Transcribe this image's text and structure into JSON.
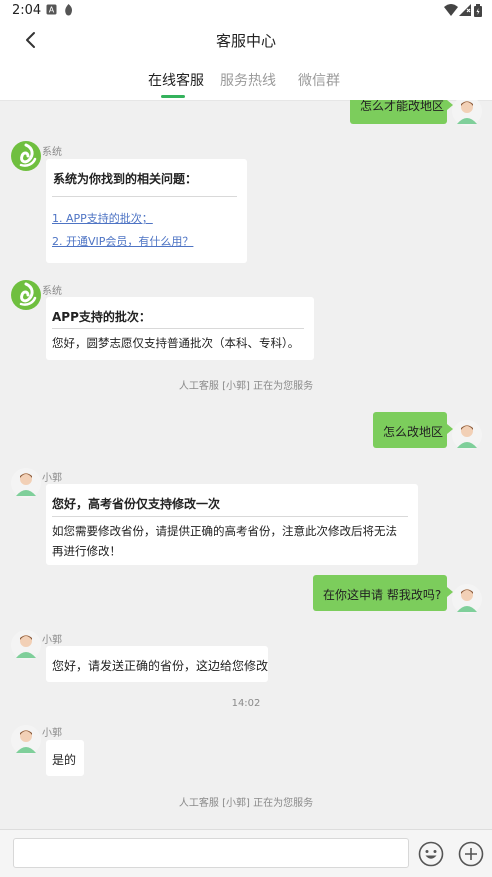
{
  "status_bar": {
    "time": "2:04"
  },
  "header": {
    "title": "客服中心",
    "tabs": [
      {
        "label": "在线客服",
        "active": true
      },
      {
        "label": "服务热线",
        "active": false
      },
      {
        "label": "微信群",
        "active": false
      }
    ]
  },
  "colors": {
    "accent": "#34b25c",
    "my_bubble": "#7ccd5c",
    "link": "#4e74c4",
    "background": "#f0f0f0"
  },
  "messages": {
    "m0": {
      "text": "怎么才能改地区"
    },
    "m1": {
      "sender": "系统",
      "title": "系统为你找到的相关问题：",
      "links": [
        "1. APP支持的批次；",
        "2. 开通VIP会员，有什么用？"
      ]
    },
    "m2": {
      "sender": "系统",
      "title": "APP支持的批次：",
      "body": "您好，圆梦志愿仅支持普通批次（本科、专科）。"
    },
    "notice1": "人工客服 [小郭] 正在为您服务",
    "m3": {
      "text": "怎么改地区"
    },
    "m4": {
      "sender": "小郭",
      "title": "您好，高考省份仅支持修改一次",
      "body": "如您需要修改省份，请提供正确的高考省份，注意此次修改后将无法再进行修改！"
    },
    "m5": {
      "text": "在你这申请 帮我改吗?"
    },
    "m6": {
      "sender": "小郭",
      "text": "您好，请发送正确的省份，这边给您修改"
    },
    "timestamp": "14:02",
    "m7": {
      "sender": "小郭",
      "text": "是的"
    },
    "notice2": "人工客服 [小郭] 正在为您服务"
  },
  "input_bar": {
    "placeholder": "",
    "emoji": "emoji-icon",
    "more": "plus-icon"
  }
}
